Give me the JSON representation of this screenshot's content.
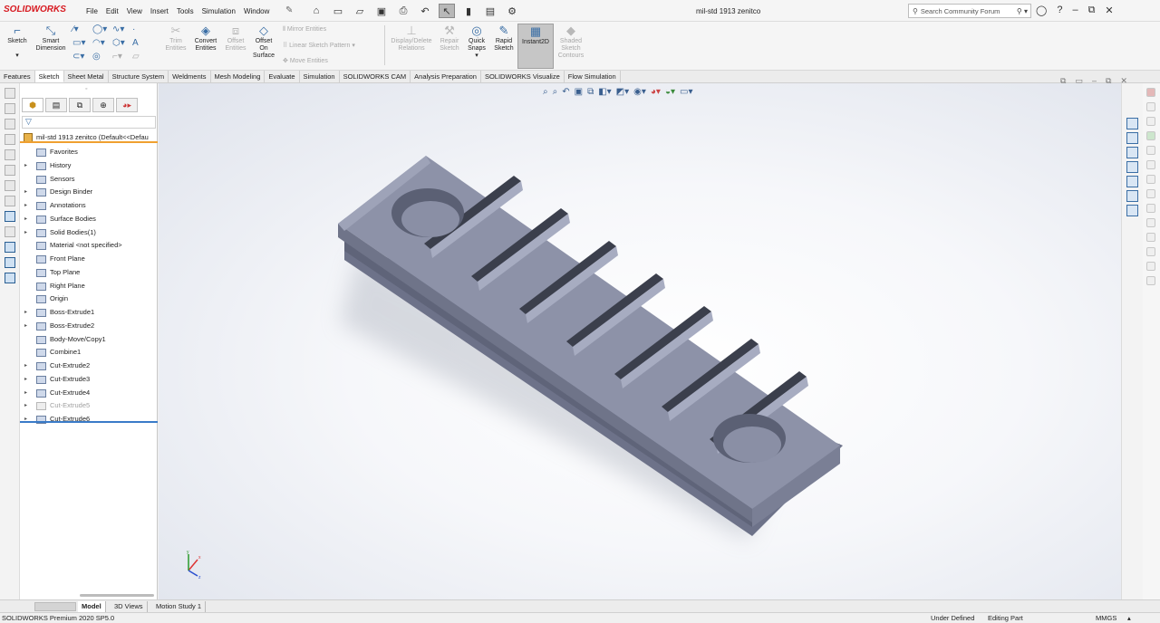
{
  "app": {
    "brand": "SOLIDWORKS",
    "title": "mil-std 1913 zenitco",
    "menu": [
      "File",
      "Edit",
      "View",
      "Insert",
      "Tools",
      "Simulation",
      "Window"
    ],
    "search_placeholder": "Search Community Forum"
  },
  "commands": {
    "sketch": "Sketch",
    "smart_dimension": "Smart Dimension",
    "trim_entities": "Trim Entities",
    "convert_entities": "Convert Entities",
    "offset_entities": "Offset Entities",
    "offset_on_surface": "Offset On Surface",
    "mirror_entities": "Mirror Entities",
    "linear_sketch_pattern": "Linear Sketch Pattern",
    "move_entities": "Move Entities",
    "display_delete_relations": "Display/Delete Relations",
    "repair_sketch": "Repair Sketch",
    "quick_snaps": "Quick Snaps",
    "rapid_sketch": "Rapid Sketch",
    "instant2d": "Instant2D",
    "shaded_sketch_contours": "Shaded Sketch Contours"
  },
  "tabs": [
    "Features",
    "Sketch",
    "Sheet Metal",
    "Structure System",
    "Weldments",
    "Mesh Modeling",
    "Evaluate",
    "Simulation",
    "SOLIDWORKS CAM",
    "Analysis Preparation",
    "SOLIDWORKS Visualize",
    "Flow Simulation"
  ],
  "active_tab": "Sketch",
  "feature_tree": {
    "root": "mil-std 1913 zenitco  (Default<<Defau",
    "items": [
      {
        "label": "Favorites",
        "expandable": false,
        "dim": false
      },
      {
        "label": "History",
        "expandable": true,
        "dim": false
      },
      {
        "label": "Sensors",
        "expandable": false,
        "dim": false
      },
      {
        "label": "Design Binder",
        "expandable": true,
        "dim": false
      },
      {
        "label": "Annotations",
        "expandable": true,
        "dim": false
      },
      {
        "label": "Surface Bodies",
        "expandable": true,
        "dim": false
      },
      {
        "label": "Solid Bodies(1)",
        "expandable": true,
        "dim": false
      },
      {
        "label": "Material <not specified>",
        "expandable": false,
        "dim": false
      },
      {
        "label": "Front Plane",
        "expandable": false,
        "dim": false
      },
      {
        "label": "Top Plane",
        "expandable": false,
        "dim": false
      },
      {
        "label": "Right Plane",
        "expandable": false,
        "dim": false
      },
      {
        "label": "Origin",
        "expandable": false,
        "dim": false
      },
      {
        "label": "Boss-Extrude1",
        "expandable": true,
        "dim": false
      },
      {
        "label": "Boss-Extrude2",
        "expandable": true,
        "dim": false
      },
      {
        "label": "Body-Move/Copy1",
        "expandable": false,
        "dim": false
      },
      {
        "label": "Combine1",
        "expandable": false,
        "dim": false
      },
      {
        "label": "Cut-Extrude2",
        "expandable": true,
        "dim": false
      },
      {
        "label": "Cut-Extrude3",
        "expandable": true,
        "dim": false
      },
      {
        "label": "Cut-Extrude4",
        "expandable": true,
        "dim": false
      },
      {
        "label": "Cut-Extrude5",
        "expandable": true,
        "dim": true
      },
      {
        "label": "Cut-Extrude6",
        "expandable": true,
        "dim": false
      }
    ]
  },
  "bottom_tabs": [
    "Model",
    "3D Views",
    "Motion Study 1"
  ],
  "active_bottom_tab": "Model",
  "status": {
    "version": "SOLIDWORKS Premium 2020 SP5.0",
    "sketch_state": "Under Defined",
    "mode": "Editing Part",
    "units": "MMGS"
  },
  "colors": {
    "brand_red": "#d71920",
    "part_top": "#8c91a8",
    "part_side": "#6a6f86",
    "accent_orange": "#f0a030",
    "selection_blue": "#3a7bc8"
  }
}
